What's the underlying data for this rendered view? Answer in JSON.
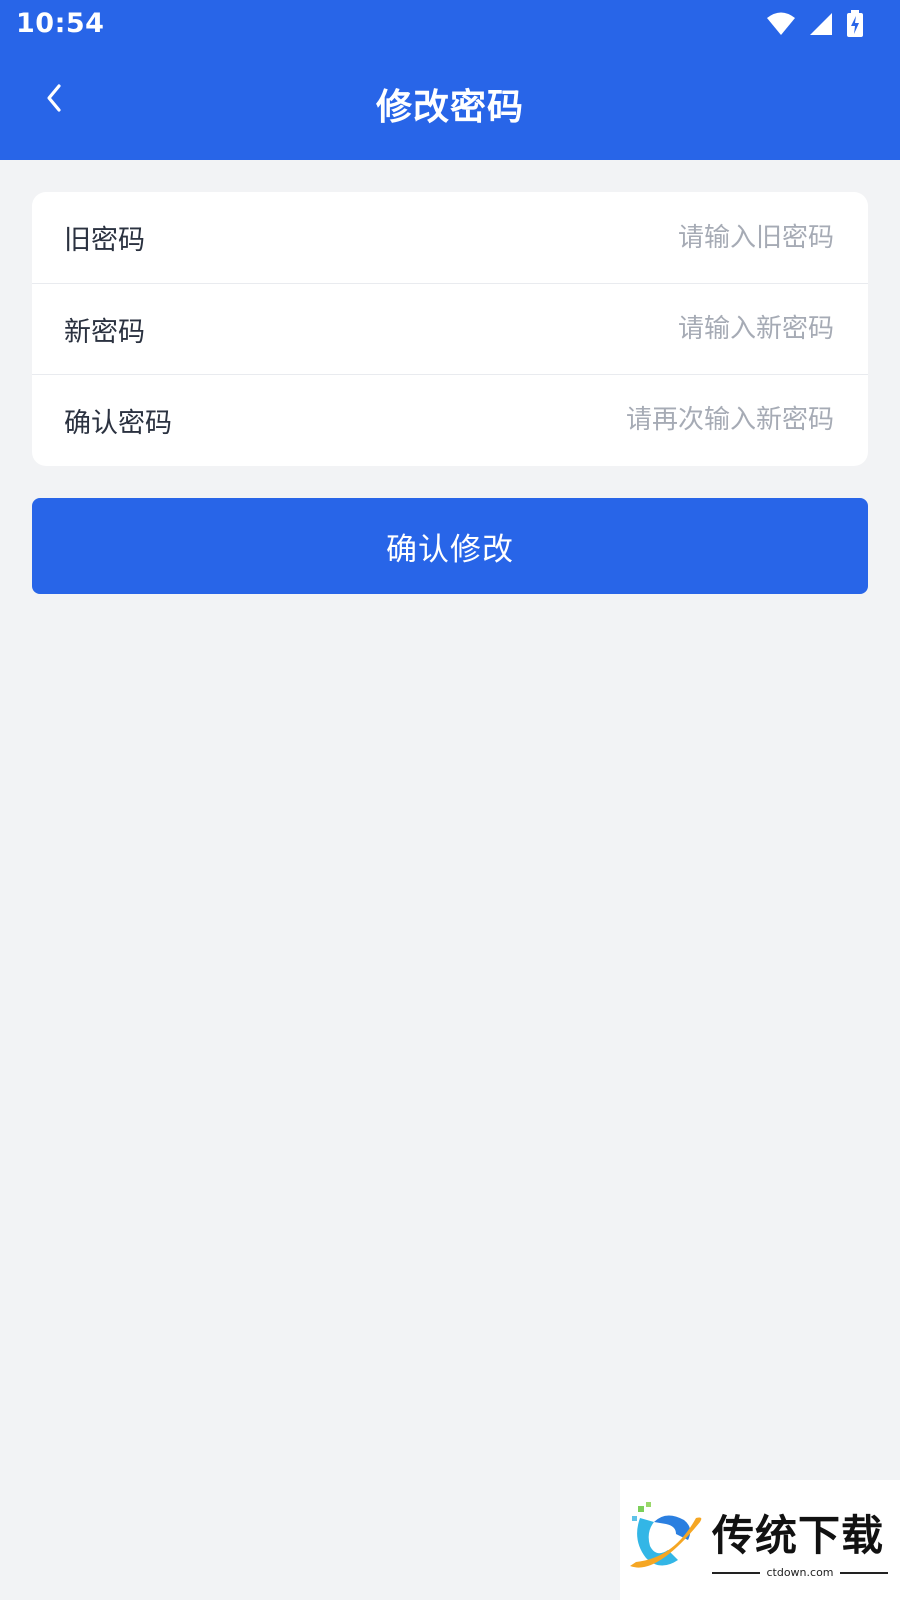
{
  "status_bar": {
    "time": "10:54",
    "icons": [
      "wifi-icon",
      "signal-icon",
      "battery-charging-icon"
    ]
  },
  "nav": {
    "back_icon": "chevron-left-icon",
    "title": "修改密码"
  },
  "form": {
    "fields": [
      {
        "label": "旧密码",
        "placeholder": "请输入旧密码",
        "value": ""
      },
      {
        "label": "新密码",
        "placeholder": "请输入新密码",
        "value": ""
      },
      {
        "label": "确认密码",
        "placeholder": "请再次输入新密码",
        "value": ""
      }
    ]
  },
  "submit": {
    "label": "确认修改"
  },
  "watermark": {
    "brand": "传统下载",
    "url": "ctdown.com"
  },
  "colors": {
    "primary": "#2865e8",
    "background": "#f2f3f5",
    "card": "#ffffff",
    "label_text": "#2b3240",
    "placeholder_text": "#a6abb5"
  }
}
